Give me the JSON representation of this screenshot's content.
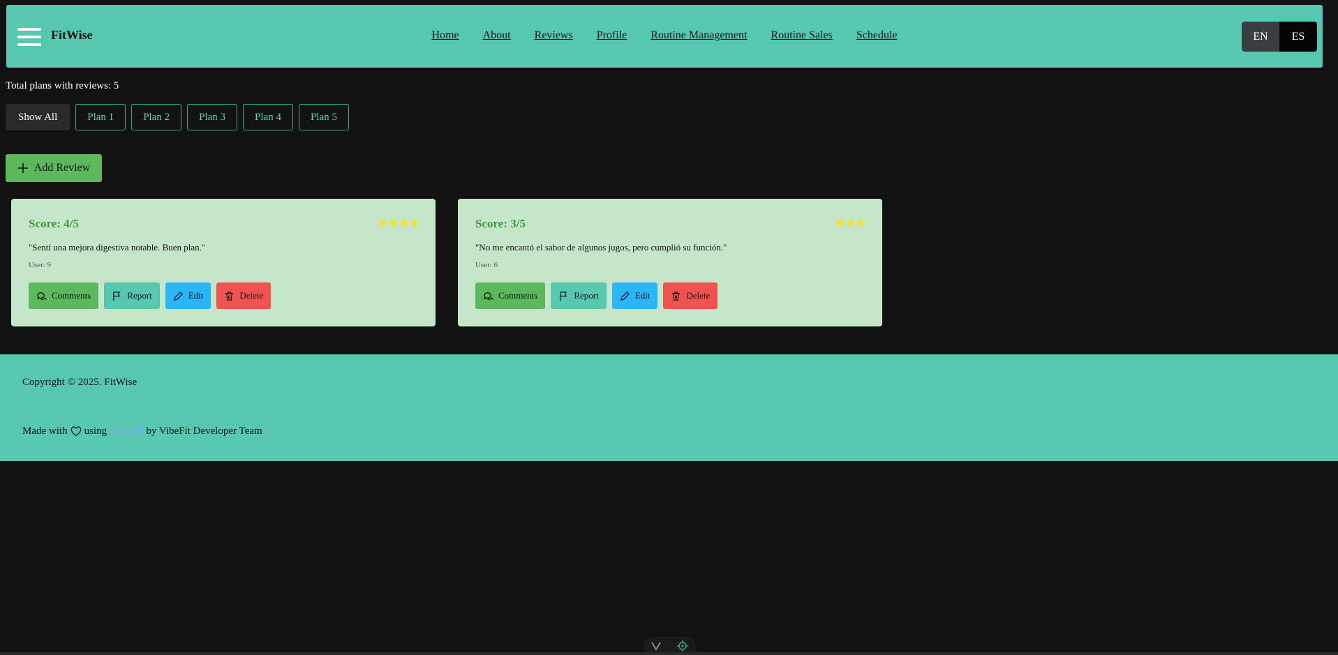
{
  "header": {
    "brand": "FitWise",
    "nav": [
      "Home",
      "About",
      "Reviews",
      "Profile",
      "Routine Management",
      "Routine Sales",
      "Schedule"
    ],
    "lang": {
      "en": "EN",
      "es": "ES"
    }
  },
  "reviews": {
    "total_text": "Total plans with reviews: 5",
    "filters": [
      "Show All",
      "Plan 1",
      "Plan 2",
      "Plan 3",
      "Plan 4",
      "Plan 5"
    ],
    "add_label": "Add Review",
    "cards": [
      {
        "score": "Score: 4/5",
        "stars": 4,
        "text": "\"Sentí una mejora digestiva notable. Buen plan.\"",
        "user": "User: 9"
      },
      {
        "score": "Score: 3/5",
        "stars": 3,
        "text": "\"No me encantó el sabor de algunos jugos, pero cumplió su función.\"",
        "user": "User: 6"
      }
    ],
    "actions": {
      "comments": "Comments",
      "report": "Report",
      "edit": "Edit",
      "delete": "Delete"
    }
  },
  "footer": {
    "copyright": "Copyright © 2025. FitWise",
    "made_prefix": "Made with",
    "made_using": "using",
    "link": "ReactJS",
    "made_suffix": "by VibeFit Developer Team"
  },
  "colors": {
    "accent": "#57c8b0",
    "background": "#121212",
    "card": "#c5e6c9",
    "success": "#5cb85c",
    "info": "#29b6f6",
    "danger": "#ef5350",
    "star": "#f3e12b"
  }
}
